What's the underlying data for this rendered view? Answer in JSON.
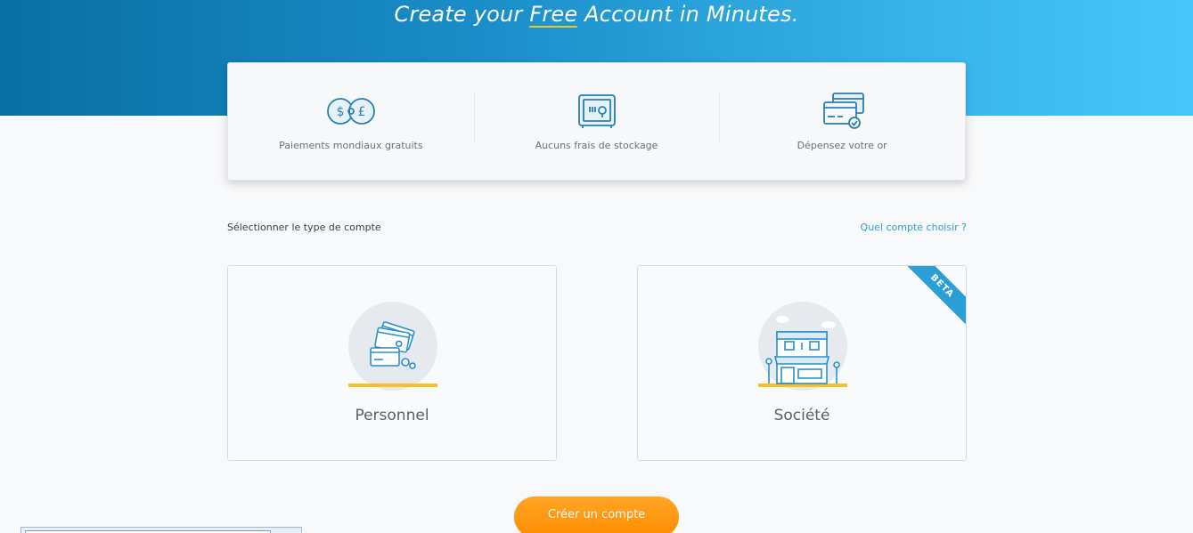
{
  "hero": {
    "title_pre": "Create your ",
    "title_free": "Free",
    "title_post": " Account in Minutes",
    "title_dot": "."
  },
  "features": [
    {
      "icon": "currency-exchange-icon",
      "label": "Paiements mondiaux gratuits"
    },
    {
      "icon": "safe-icon",
      "label": "Aucuns frais de stockage"
    },
    {
      "icon": "credit-cards-icon",
      "label": "Dépensez votre or"
    }
  ],
  "account_section": {
    "select_label": "Sélectionner le type de compte",
    "help_link": "Quel compte choisir ?"
  },
  "accounts": {
    "personal": {
      "label": "Personnel",
      "icon": "cards-illustration-icon"
    },
    "company": {
      "label": "Société",
      "icon": "storefront-illustration-icon",
      "badge": "BETA"
    }
  },
  "cta": {
    "label": "Créer un compte"
  },
  "colors": {
    "accent": "#2a9fd6",
    "cta": "#ff9900",
    "highlight": "#f5c518",
    "hero_start": "#0a6fa3",
    "hero_end": "#47c6fa"
  }
}
